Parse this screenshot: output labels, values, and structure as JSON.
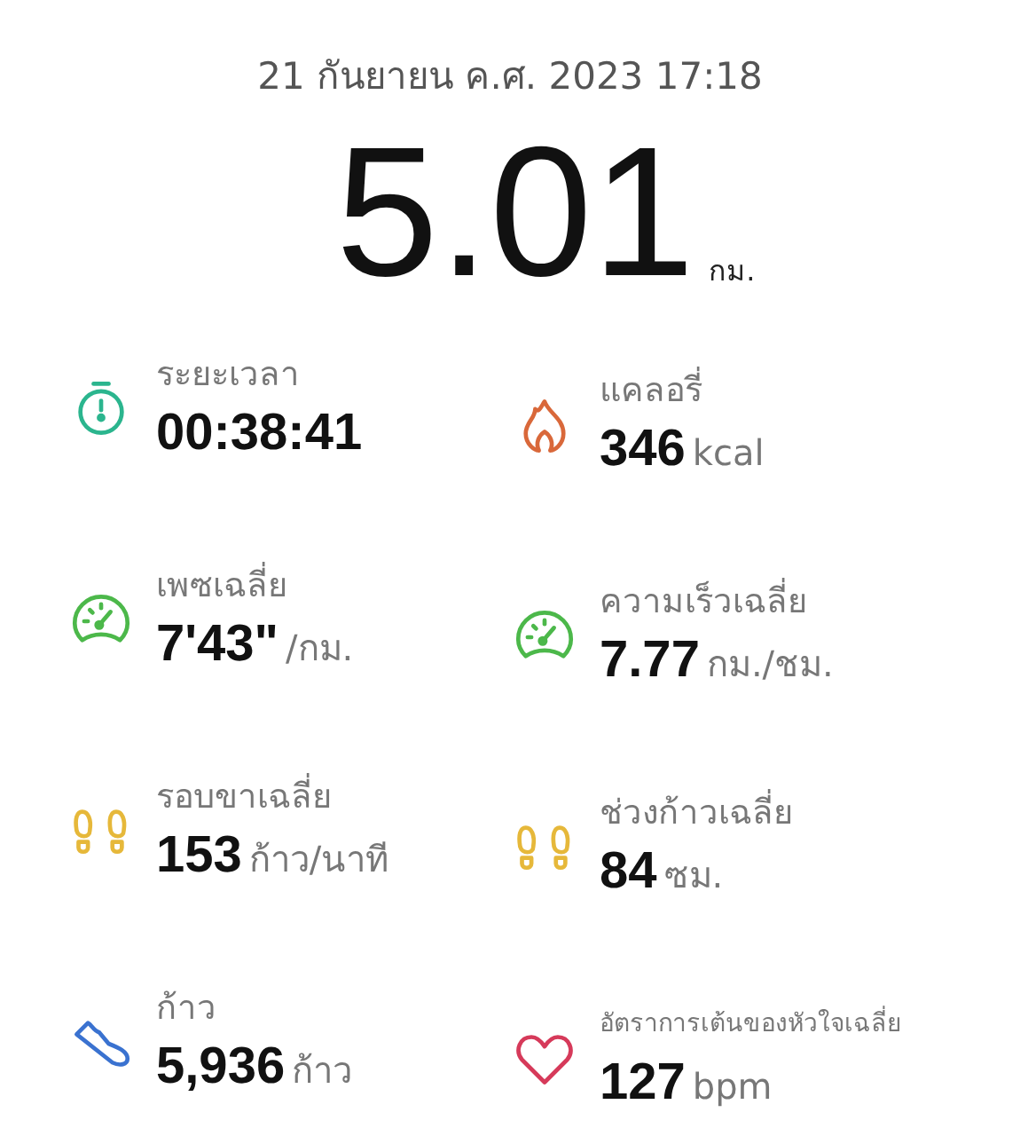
{
  "date": "21 กันยายน ค.ศ. 2023 17:18",
  "distance": {
    "value": "5.01",
    "unit": "กม."
  },
  "stats": [
    {
      "kind": "stopwatch",
      "color": "#2bb58e",
      "label": "ระยะเวลา",
      "value": "00:38:41",
      "compact": false
    },
    {
      "kind": "flame",
      "color": "#d9683a",
      "label": "แคลอรี่",
      "value": "346",
      "unit": "kcal",
      "compact": false
    },
    {
      "kind": "gauge",
      "color": "#4cb84a",
      "label": "เพซเฉลี่ย",
      "value": "7'43\"",
      "unit": "/กม.",
      "compact": false
    },
    {
      "kind": "gauge",
      "color": "#4cb84a",
      "label": "ความเร็วเฉลี่ย",
      "value": "7.77",
      "unit": "กม./ชม.",
      "compact": false
    },
    {
      "kind": "footprints",
      "color": "#e6b83a",
      "label": "รอบขาเฉลี่ย",
      "value": "153",
      "unit": "ก้าว/นาที",
      "compact": false
    },
    {
      "kind": "footprints",
      "color": "#e6b83a",
      "label": "ช่วงก้าวเฉลี่ย",
      "value": "84",
      "unit": "ซม.",
      "compact": false
    },
    {
      "kind": "shoe",
      "color": "#3a72d0",
      "label": "ก้าว",
      "value": "5,936",
      "unit": "ก้าว",
      "compact": false
    },
    {
      "kind": "heart",
      "color": "#d63a5a",
      "label": "อัตราการเต้นของหัวใจเฉลี่ย",
      "value": "127",
      "unit": "bpm",
      "compact": true
    }
  ]
}
